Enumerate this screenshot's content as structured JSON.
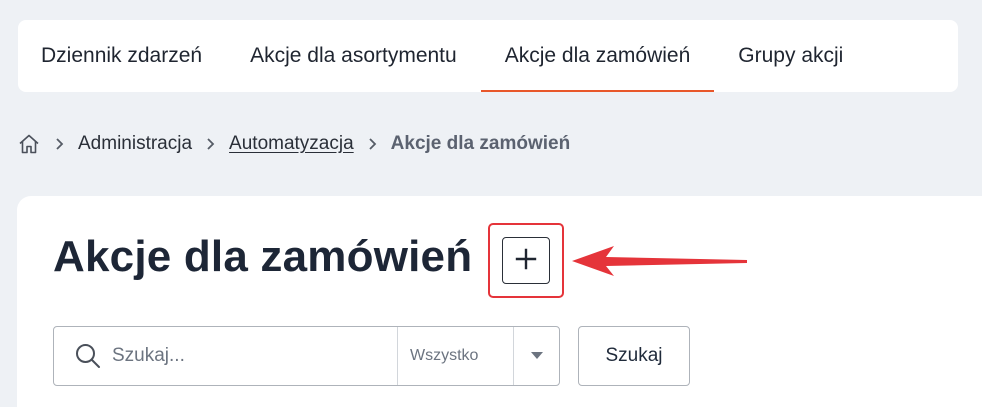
{
  "tabs": [
    {
      "label": "Dziennik zdarzeń",
      "active": false
    },
    {
      "label": "Akcje dla asortymentu",
      "active": false
    },
    {
      "label": "Akcje dla zamówień",
      "active": true
    },
    {
      "label": "Grupy akcji",
      "active": false
    }
  ],
  "breadcrumb": {
    "home_icon": "home-icon",
    "items": [
      "Administracja",
      "Automatyzacja",
      "Akcje dla zamówień"
    ]
  },
  "main": {
    "title": "Akcje dla zamówień",
    "add_button_icon": "plus-icon"
  },
  "search": {
    "placeholder": "Szukaj...",
    "value": "",
    "scope_selected": "Wszystko",
    "submit_label": "Szukaj"
  },
  "colors": {
    "accent": "#e8572a",
    "annotation": "#e5343a",
    "background": "#eef1f5"
  }
}
